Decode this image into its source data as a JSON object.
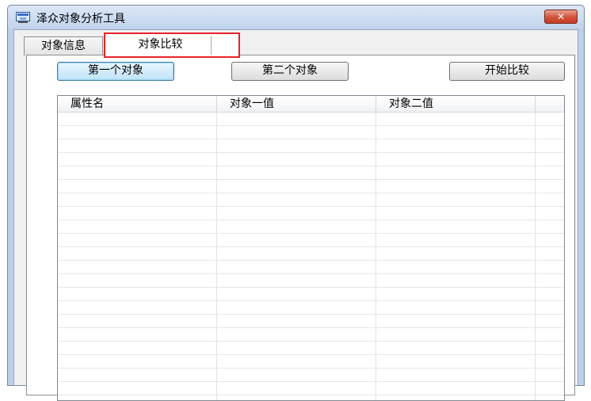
{
  "window": {
    "title": "泽众对象分析工具",
    "close_label": "✕"
  },
  "tabs": [
    {
      "label": "对象信息",
      "selected": false
    },
    {
      "label": "对象比较",
      "selected": true
    }
  ],
  "toolbar": {
    "first_object_label": "第一个对象",
    "second_object_label": "第二个对象",
    "start_compare_label": "开始比较"
  },
  "table": {
    "columns": [
      "属性名",
      "对象一值",
      "对象二值"
    ],
    "rows": []
  },
  "colors": {
    "highlight": "#e8232a",
    "focus_button": "#bfe3f8"
  },
  "icons": {
    "app": "app-window-icon",
    "close": "close-icon"
  }
}
